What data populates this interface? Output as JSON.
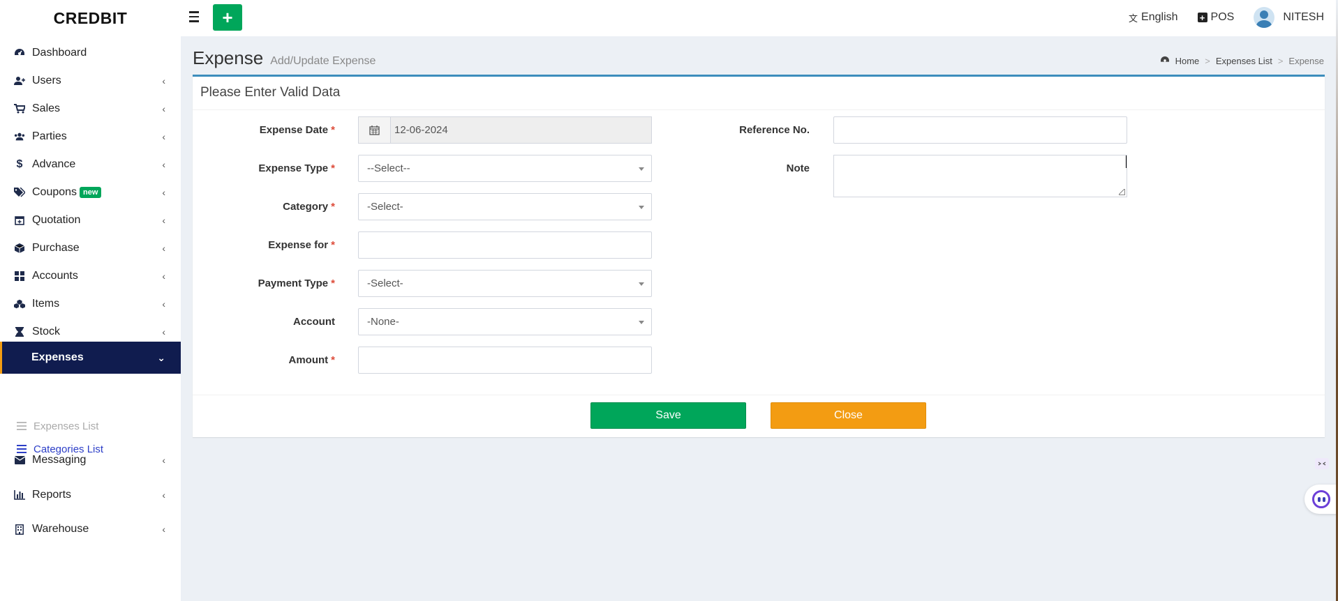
{
  "header": {
    "brand": "CREDBIT",
    "language_label": "English",
    "pos_label": "POS",
    "user_name": "NITESH"
  },
  "sidebar": {
    "items": [
      {
        "label": "Dashboard",
        "icon": "dashboard-icon"
      },
      {
        "label": "Users",
        "icon": "user-plus-icon"
      },
      {
        "label": "Sales",
        "icon": "cart-icon"
      },
      {
        "label": "Parties",
        "icon": "users-icon"
      },
      {
        "label": "Advance",
        "icon": "dollar-icon"
      },
      {
        "label": "Coupons",
        "icon": "tags-icon",
        "badge": "new"
      },
      {
        "label": "Quotation",
        "icon": "calendar-plus-icon"
      },
      {
        "label": "Purchase",
        "icon": "cube-icon"
      },
      {
        "label": "Accounts",
        "icon": "grid-icon"
      },
      {
        "label": "Items",
        "icon": "cubes-icon"
      },
      {
        "label": "Stock",
        "icon": "hourglass-icon"
      },
      {
        "label": "Expenses",
        "icon": "none",
        "active": true
      },
      {
        "label": "Messaging",
        "icon": "envelope-icon"
      },
      {
        "label": "Reports",
        "icon": "bar-chart-icon"
      },
      {
        "label": "Warehouse",
        "icon": "building-icon"
      }
    ],
    "sub_items": [
      {
        "label": "Expenses List"
      },
      {
        "label": "Categories List"
      }
    ]
  },
  "page": {
    "title": "Expense",
    "subtitle": "Add/Update Expense",
    "breadcrumb": [
      "Home",
      "Expenses List",
      "Expense"
    ]
  },
  "form": {
    "box_title": "Please Enter Valid Data",
    "expense_date_label": "Expense Date",
    "expense_date_value": "12-06-2024",
    "expense_type_label": "Expense Type",
    "expense_type_value": "--Select--",
    "category_label": "Category",
    "category_value": "-Select-",
    "expense_for_label": "Expense for",
    "payment_type_label": "Payment Type",
    "payment_type_value": "-Select-",
    "account_label": "Account",
    "account_value": "-None-",
    "amount_label": "Amount",
    "reference_label": "Reference No.",
    "note_label": "Note",
    "required_mark": "*",
    "save_label": "Save",
    "close_label": "Close"
  },
  "colors": {
    "sidebar_active_bg": "#101c4f",
    "save_green": "#00a65a",
    "close_orange": "#f39c12",
    "box_border_blue": "#3c8dbc"
  }
}
